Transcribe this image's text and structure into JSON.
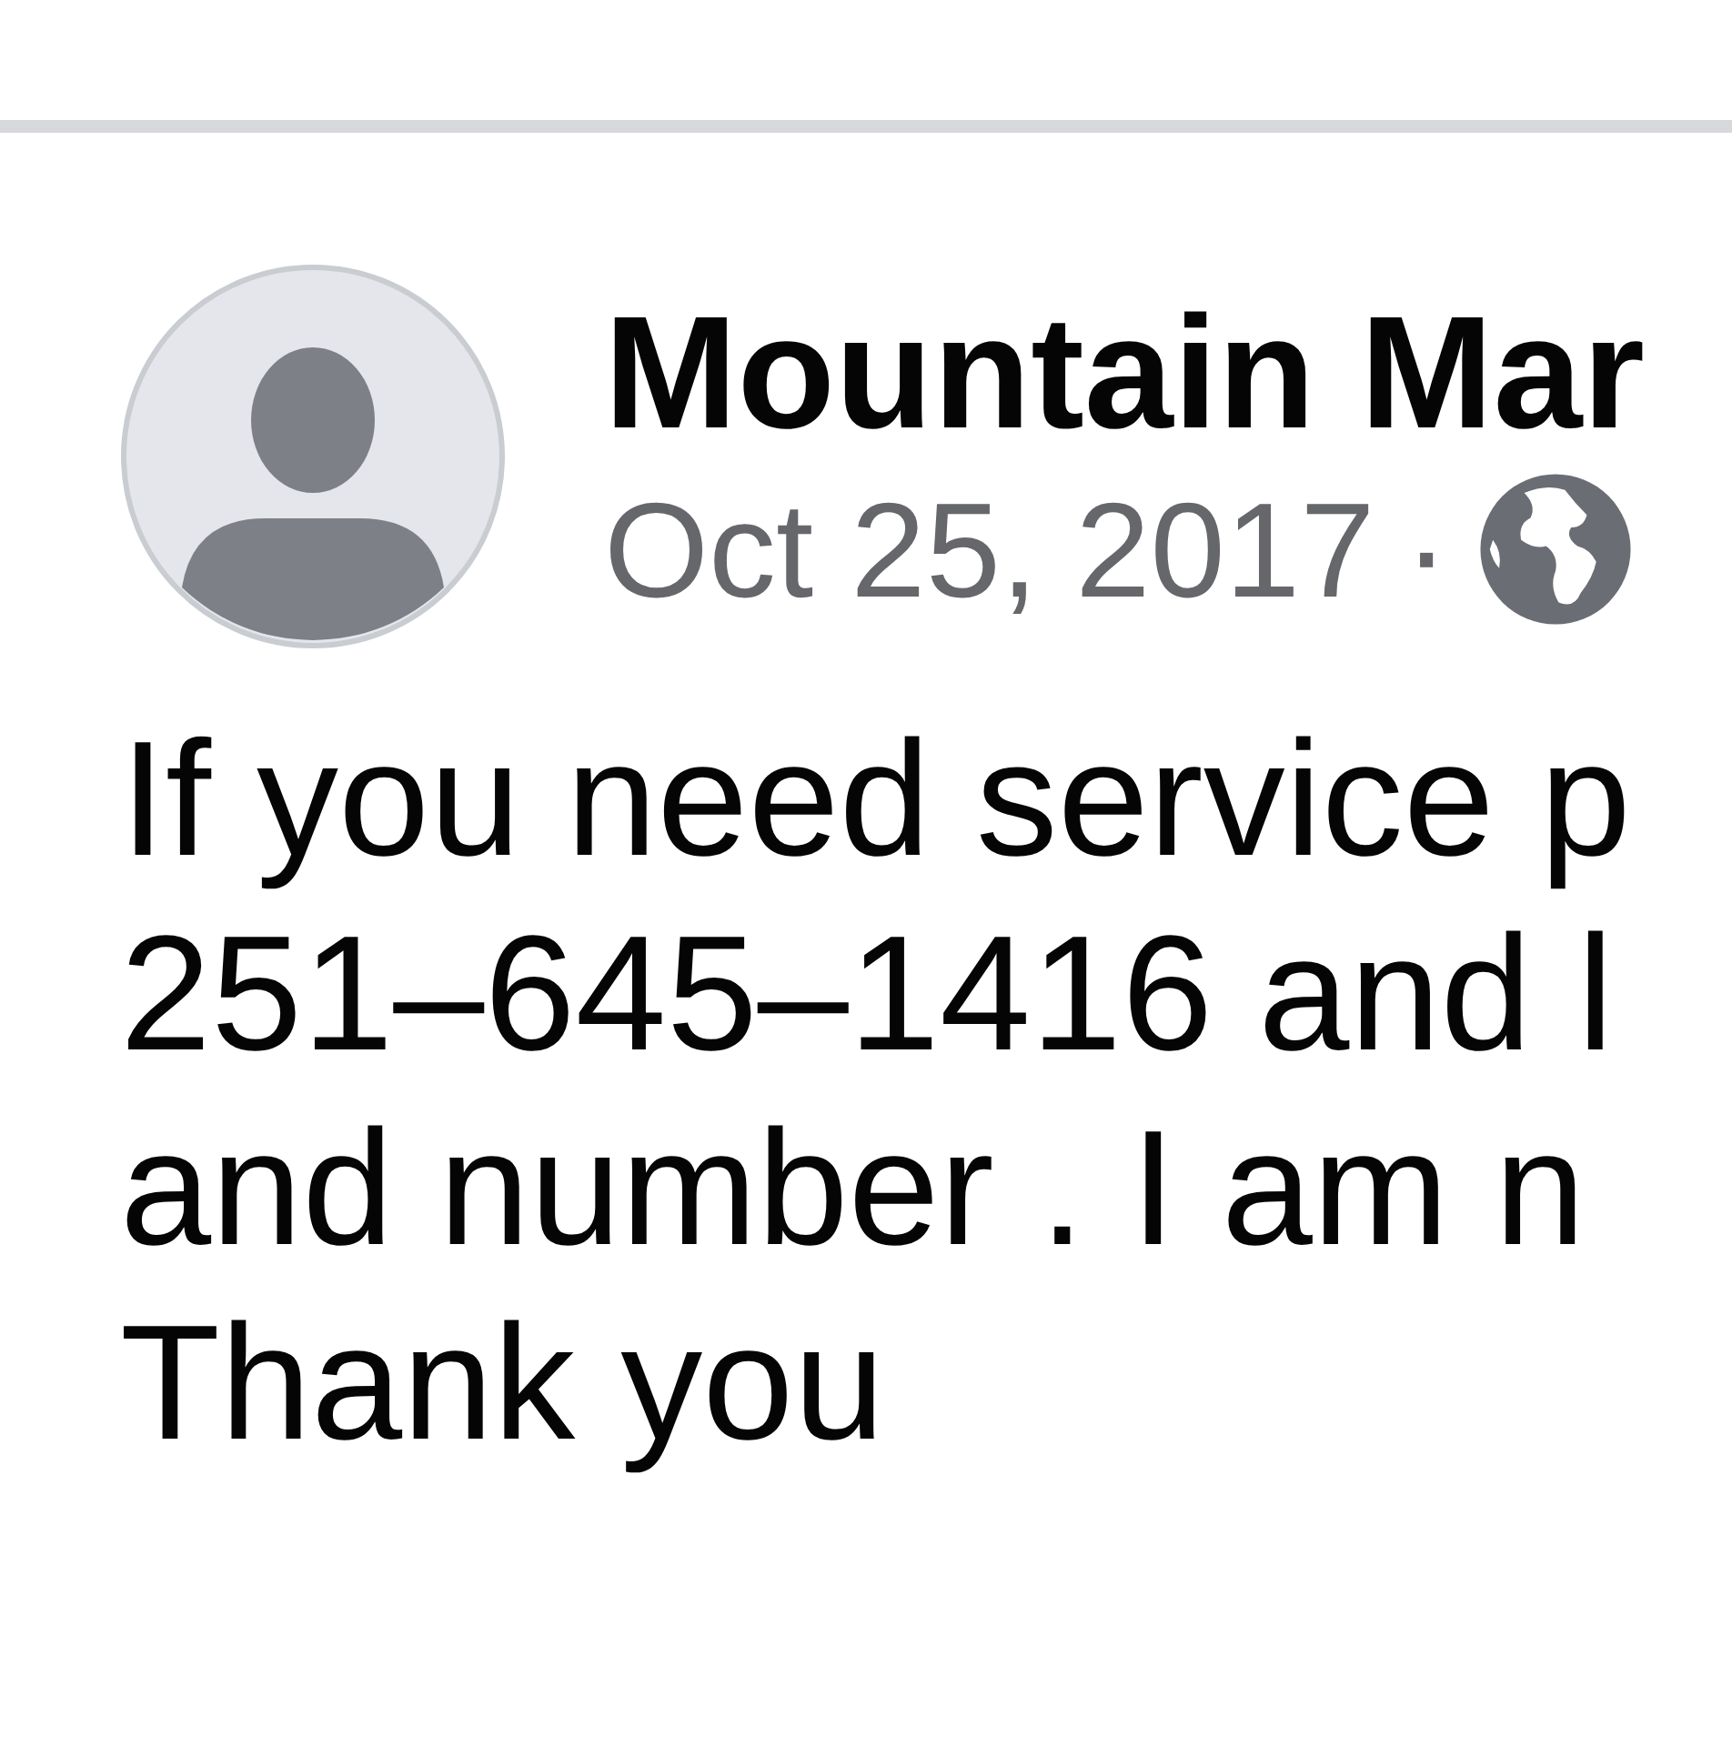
{
  "post": {
    "author": "Mountain Mar",
    "date": "Oct 25, 2017",
    "separator": "·",
    "text_lines": [
      "If you need service p",
      "251–645–1416 and l",
      "and number . I am n",
      "Thank you"
    ]
  }
}
